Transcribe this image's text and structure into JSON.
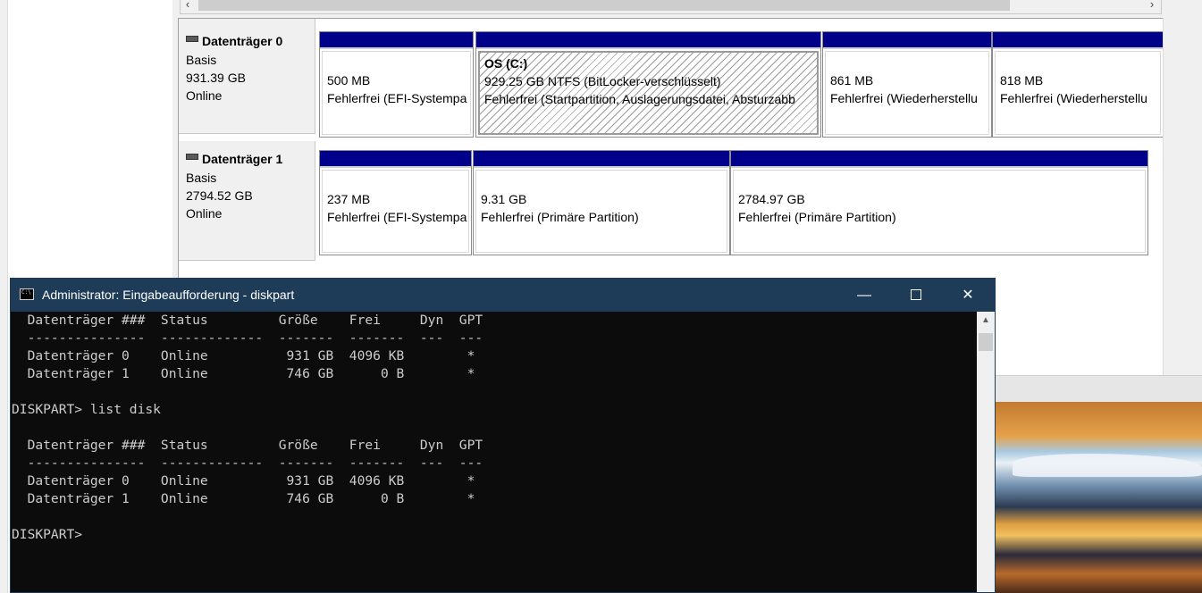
{
  "disk_manager": {
    "disks": [
      {
        "name": "Datenträger 0",
        "type": "Basis",
        "size": "931.39 GB",
        "status": "Online",
        "partitions": [
          {
            "title": "",
            "line1": "500 MB",
            "line2": "Fehlerfrei (EFI-Systempa",
            "selected": false
          },
          {
            "title": "OS  (C:)",
            "line1": "929.25 GB NTFS (BitLocker-verschlüsselt)",
            "line2": "Fehlerfrei (Startpartition, Auslagerungsdatei, Absturzabb",
            "selected": true
          },
          {
            "title": "",
            "line1": "861 MB",
            "line2": "Fehlerfrei (Wiederherstellu",
            "selected": false
          },
          {
            "title": "",
            "line1": "818 MB",
            "line2": "Fehlerfrei (Wiederherstellu",
            "selected": false
          }
        ]
      },
      {
        "name": "Datenträger 1",
        "type": "Basis",
        "size": "2794.52 GB",
        "status": "Online",
        "partitions": [
          {
            "title": "",
            "line1": "237 MB",
            "line2": "Fehlerfrei (EFI-Systempa",
            "selected": false
          },
          {
            "title": "",
            "line1": "9.31 GB",
            "line2": "Fehlerfrei (Primäre Partition)",
            "selected": false
          },
          {
            "title": "",
            "line1": "2784.97 GB",
            "line2": "Fehlerfrei (Primäre Partition)",
            "selected": false
          }
        ]
      }
    ],
    "scroll_left_icon": "chevron-left-icon",
    "scroll_right_icon": "chevron-right-icon"
  },
  "console": {
    "title": "Administrator: Eingabeaufforderung - diskpart",
    "buttons": {
      "minimize": "—",
      "maximize": "",
      "close": "✕"
    },
    "lines": [
      "  Datenträger ###  Status         Größe    Frei     Dyn  GPT",
      "  ---------------  -------------  -------  -------  ---  ---",
      "  Datenträger 0    Online          931 GB  4096 KB        *",
      "  Datenträger 1    Online          746 GB      0 B        *",
      "",
      "DISKPART> list disk",
      "",
      "  Datenträger ###  Status         Größe    Frei     Dyn  GPT",
      "  ---------------  -------------  -------  -------  ---  ---",
      "  Datenträger 0    Online          931 GB  4096 KB        *",
      "  Datenträger 1    Online          746 GB      0 B        *",
      "",
      "DISKPART> "
    ]
  },
  "colors": {
    "partition_bar": "#00008b",
    "console_titlebar": "#1e3c57",
    "console_bg": "#0c0c0c",
    "console_text": "#cccccc"
  }
}
